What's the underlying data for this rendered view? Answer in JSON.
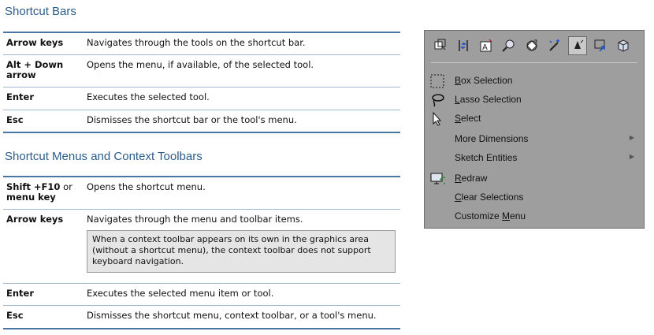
{
  "section1": {
    "title": "Shortcut Bars",
    "rows": [
      {
        "key": "Arrow keys",
        "desc": "Navigates through the tools on the shortcut bar."
      },
      {
        "key": "Alt + Down arrow",
        "desc": "Opens the menu, if available, of the selected tool."
      },
      {
        "key": "Enter",
        "desc": "Executes the selected tool."
      },
      {
        "key": "Esc",
        "desc": "Dismisses the shortcut bar or the tool's menu."
      }
    ]
  },
  "section2": {
    "title": "Shortcut Menus and Context Toolbars",
    "rows": [
      {
        "key_bold": "Shift +F10",
        "key_plain": " or",
        "key_bold2": "menu key",
        "desc": "Opens the shortcut menu."
      },
      {
        "key": "Arrow keys",
        "desc": "Navigates through the menu and toolbar items.",
        "note": "When a context toolbar appears on its own in the graphics area (without a shortcut menu), the context toolbar does not support keyboard navigation."
      },
      {
        "key": "Enter",
        "desc": "Executes the selected menu item or tool."
      },
      {
        "key": "Esc",
        "desc": "Dismisses the shortcut menu, context toolbar, or a tool's menu."
      }
    ]
  },
  "toolbar": {
    "buttons": [
      "view-orientation-icon",
      "sketch-relations-icon",
      "smart-dimension-icon",
      "zoom-icon",
      "rotate-view-icon",
      "magic-select-icon",
      "select-tool-icon",
      "undo-arrow-icon",
      "part-3d-icon"
    ],
    "active_index": 6
  },
  "menu": {
    "items": [
      {
        "pre": "",
        "u": "B",
        "post": "ox Selection",
        "icon": "box-selection-icon"
      },
      {
        "pre": "",
        "u": "L",
        "post": "asso Selection",
        "icon": "lasso-icon"
      },
      {
        "pre": "",
        "u": "S",
        "post": "elect",
        "icon": "cursor-arrow-icon"
      },
      {
        "pre": "More Dimensions",
        "u": "",
        "post": "",
        "submenu": true
      },
      {
        "pre": "Sketch Entities",
        "u": "",
        "post": "",
        "submenu": true
      },
      {
        "pre": "",
        "u": "R",
        "post": "edraw",
        "icon": "redraw-icon"
      },
      {
        "pre": "",
        "u": "C",
        "post": "lear Selections"
      },
      {
        "pre": "Customize ",
        "u": "M",
        "post": "enu"
      }
    ]
  },
  "colors": {
    "title": "#2a5c8a",
    "rule": "#4a76a3",
    "panel": "#9e9e9e"
  }
}
